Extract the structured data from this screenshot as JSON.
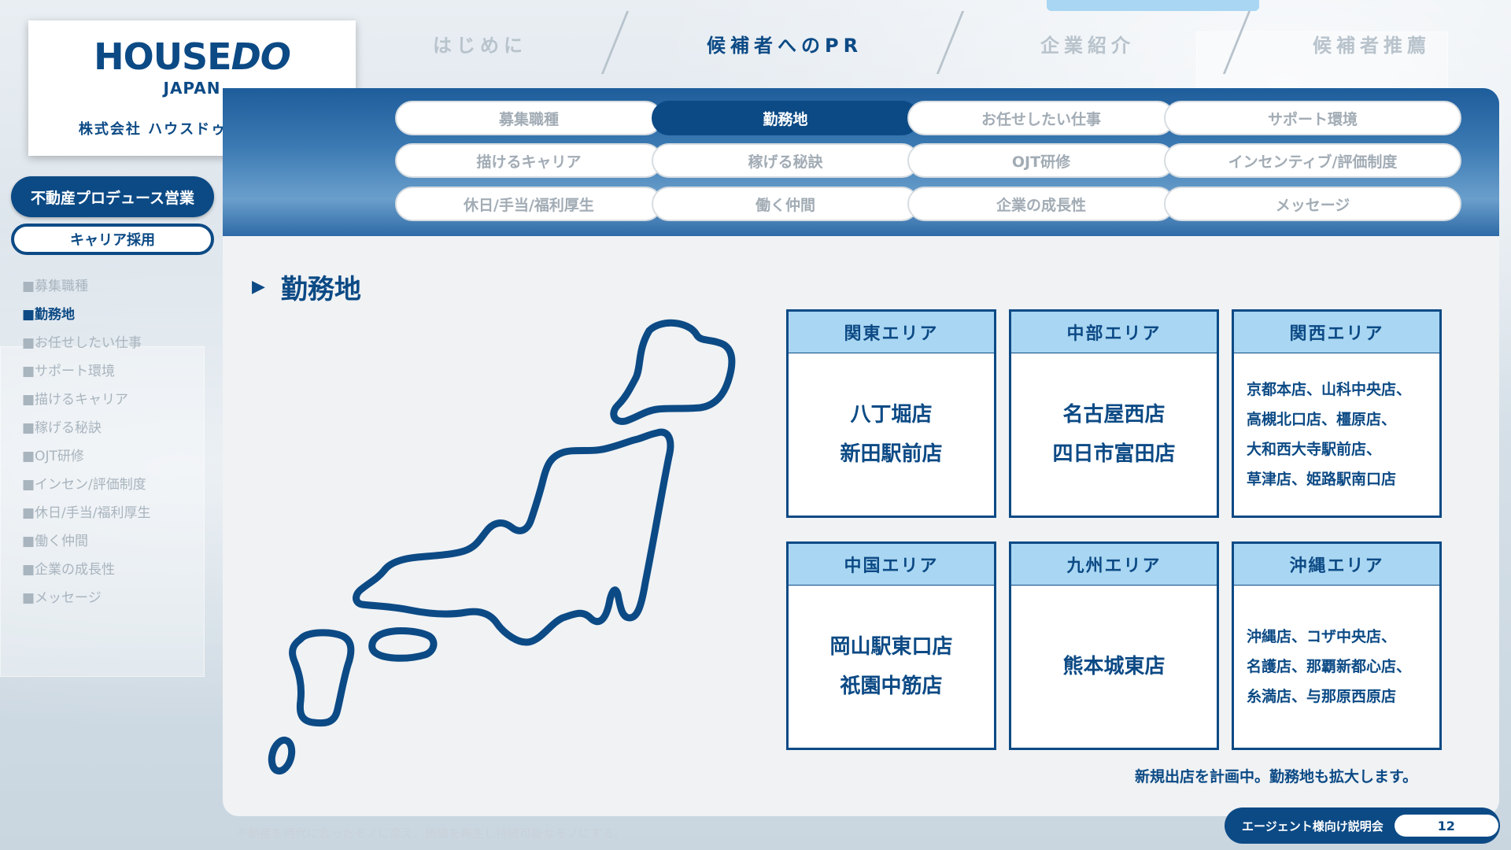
{
  "brand": {
    "logo_main": "HOUSE",
    "logo_do": "DO",
    "logo_sub": "JAPAN",
    "company": "株式会社 ハウスドゥ・ジャパン"
  },
  "side": {
    "primary_button": "不動産プロデュース営業",
    "secondary_button": "キャリア採用",
    "items": [
      {
        "label": "■募集職種"
      },
      {
        "label": "■勤務地"
      },
      {
        "label": "■お任せしたい仕事"
      },
      {
        "label": "■サポート環境"
      },
      {
        "label": "■描けるキャリア"
      },
      {
        "label": "■稼げる秘訣"
      },
      {
        "label": "■OJT研修"
      },
      {
        "label": "■インセン/評価制度"
      },
      {
        "label": "■休日/手当/福利厚生"
      },
      {
        "label": "■働く仲間"
      },
      {
        "label": "■企業の成長性"
      },
      {
        "label": "■メッセージ"
      }
    ],
    "active_index": 1
  },
  "top_tabs": {
    "items": [
      {
        "label": "はじめに"
      },
      {
        "label": "候補者へのPR"
      },
      {
        "label": "企業紹介"
      },
      {
        "label": "候補者推薦"
      }
    ],
    "active_index": 1
  },
  "subnav": {
    "items": [
      {
        "label": "募集職種"
      },
      {
        "label": "勤務地"
      },
      {
        "label": "お任せしたい仕事"
      },
      {
        "label": "サポート環境"
      },
      {
        "label": "描けるキャリア"
      },
      {
        "label": "稼げる秘訣"
      },
      {
        "label": "OJT研修"
      },
      {
        "label": "インセンティブ/評価制度"
      },
      {
        "label": "休日/手当/福利厚生"
      },
      {
        "label": "働く仲間"
      },
      {
        "label": "企業の成長性"
      },
      {
        "label": "メッセージ"
      }
    ],
    "active_index": 1
  },
  "main": {
    "title": "勤務地",
    "areas": [
      {
        "name": "関東エリア",
        "stores": [
          "八丁堀店",
          "新田駅前店"
        ],
        "style": "big"
      },
      {
        "name": "中部エリア",
        "stores": [
          "名古屋西店",
          "四日市富田店"
        ],
        "style": "big"
      },
      {
        "name": "関西エリア",
        "stores": [
          "京都本店、山科中央店、",
          "高槻北口店、橿原店、",
          "大和西大寺駅前店、",
          "草津店、姫路駅南口店"
        ],
        "style": "small"
      },
      {
        "name": "中国エリア",
        "stores": [
          "岡山駅東口店",
          "祇園中筋店"
        ],
        "style": "big"
      },
      {
        "name": "九州エリア",
        "stores": [
          "熊本城東店"
        ],
        "style": "big"
      },
      {
        "name": "沖縄エリア",
        "stores": [
          "沖縄店、コザ中央店、",
          "名護店、那覇新都心店、",
          "糸満店、与那原西原店"
        ],
        "style": "small"
      }
    ],
    "note": "新規出店を計画中。勤務地も拡大します。"
  },
  "footer": {
    "tagline": "不動産を時代に合ったモノに変え、価値を再生し持続可能なモノにする。",
    "badge_label": "エージェント様向け説明会",
    "page_number": "12"
  },
  "colors": {
    "primary": "#0c4a85",
    "light": "#a9d6f2",
    "muted": "#a8b4be"
  }
}
